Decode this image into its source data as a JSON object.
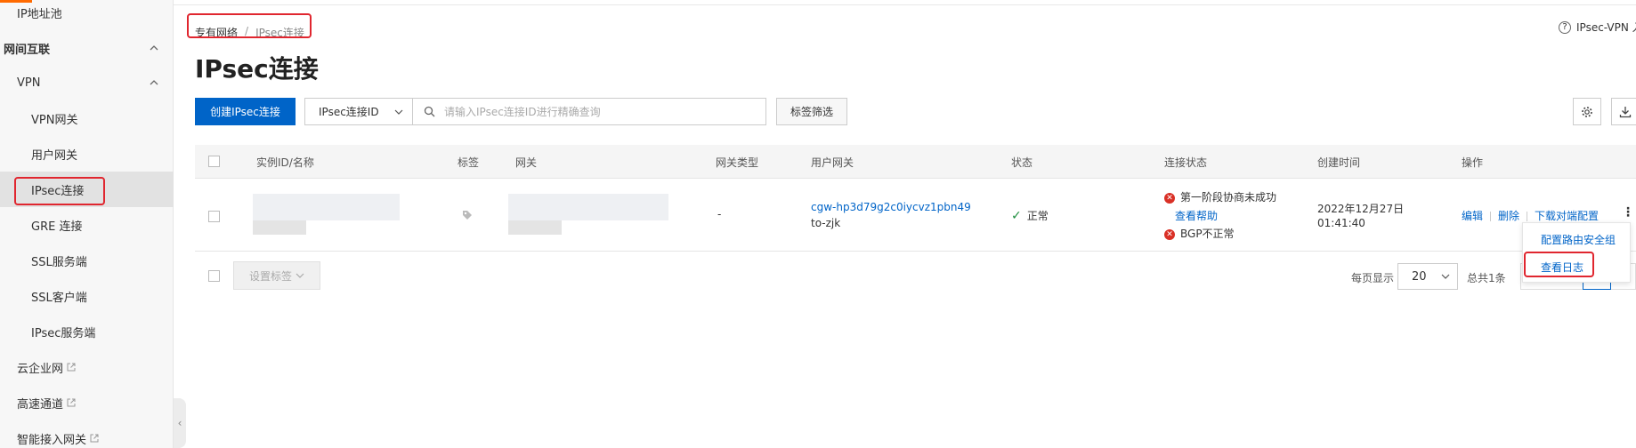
{
  "sidebar": {
    "items": [
      {
        "label": "IP地址池",
        "type": "sub"
      },
      {
        "label": "网间互联",
        "type": "group"
      },
      {
        "label": "VPN",
        "type": "sub"
      },
      {
        "label": "VPN网关",
        "type": "leaf"
      },
      {
        "label": "用户网关",
        "type": "leaf"
      },
      {
        "label": "IPsec连接",
        "type": "leaf",
        "active": true
      },
      {
        "label": "GRE 连接",
        "type": "leaf"
      },
      {
        "label": "SSL服务端",
        "type": "leaf"
      },
      {
        "label": "SSL客户端",
        "type": "leaf"
      },
      {
        "label": "IPsec服务端",
        "type": "leaf"
      },
      {
        "label": "云企业网",
        "type": "sub",
        "external": true
      },
      {
        "label": "高速通道",
        "type": "sub",
        "external": true
      },
      {
        "label": "智能接入网关",
        "type": "sub",
        "external": true
      }
    ]
  },
  "breadcrumb": {
    "parent": "专有网络",
    "separator": "/",
    "current": "IPsec连接"
  },
  "help": {
    "label": "IPsec-VPN 入"
  },
  "page_title": "IPsec连接",
  "toolbar": {
    "create_label": "创建IPsec连接",
    "filter_select": "IPsec连接ID",
    "search_placeholder": "请输入IPsec连接ID进行精确查询",
    "tag_filter_label": "标签筛选"
  },
  "table": {
    "headers": [
      "实例ID/名称",
      "标签",
      "网关",
      "网关类型",
      "用户网关",
      "状态",
      "连接状态",
      "创建时间",
      "操作"
    ],
    "rows": [
      {
        "gateway_type": "-",
        "customer_gateway_id": "cgw-hp3d79g2c0iycvz1pbn49",
        "customer_gateway_name": "to-zjk",
        "status": "正常",
        "conn_status_1": "第一阶段协商未成功",
        "conn_help": "查看帮助",
        "conn_status_2": "BGP不正常",
        "created_date": "2022年12月27日",
        "created_time": "01:41:40",
        "op_edit": "编辑",
        "op_delete": "删除",
        "op_download": "下载对端配置"
      }
    ]
  },
  "footer": {
    "set_tag_label": "设置标签",
    "page_size_label": "每页显示",
    "page_size": "20",
    "total_label": "总共1条"
  },
  "dropdown": {
    "items": [
      "配置路由安全组",
      "查看日志"
    ]
  },
  "colors": {
    "primary": "#0064c8",
    "accent": "#ff6a00",
    "error": "#d93026",
    "success": "#1e8e3e",
    "highlight": "#e0262f"
  }
}
